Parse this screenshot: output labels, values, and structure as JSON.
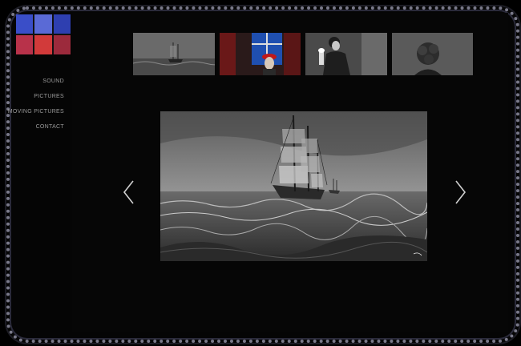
{
  "logo": {
    "letters": [
      "",
      "",
      "",
      "",
      "",
      ""
    ]
  },
  "nav": {
    "items": [
      {
        "label": "SOUND"
      },
      {
        "label": "PICTURES"
      },
      {
        "label": "MOVING PICTURES"
      },
      {
        "label": "CONTACT"
      }
    ]
  },
  "gallery": {
    "thumbnails": [
      "ship-at-sea",
      "girl-in-red-hat",
      "woman-with-lamp",
      "curly-haired-figure"
    ],
    "current_image": "ship-at-sea"
  },
  "colors": {
    "background": "#000000",
    "nav_text": "#9a9a9a",
    "logo_blue": "#3a4ec8",
    "logo_red": "#d23a3a"
  }
}
